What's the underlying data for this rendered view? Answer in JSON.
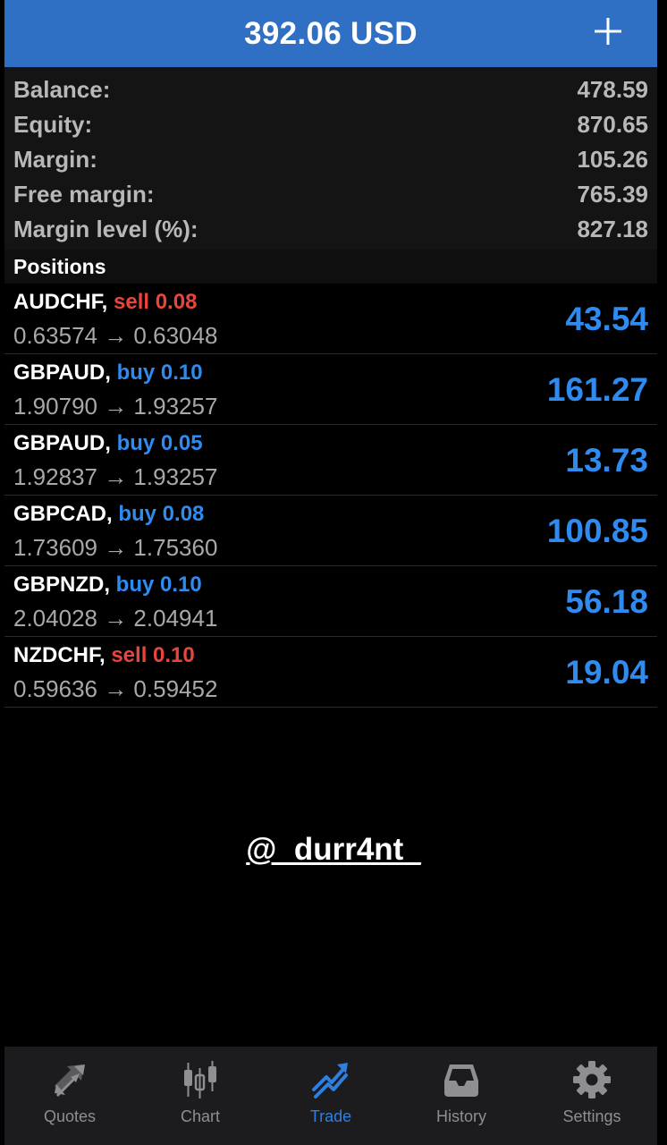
{
  "header": {
    "title": "392.06 USD"
  },
  "summary": [
    {
      "label": "Balance:",
      "value": "478.59"
    },
    {
      "label": "Equity:",
      "value": "870.65"
    },
    {
      "label": "Margin:",
      "value": "105.26"
    },
    {
      "label": "Free margin:",
      "value": "765.39"
    },
    {
      "label": "Margin level (%):",
      "value": "827.18"
    }
  ],
  "positions": {
    "title": "Positions",
    "items": [
      {
        "symbol": "AUDCHF,",
        "type": "sell 0.08",
        "side": "sell",
        "prices": "0.63574 → 0.63048",
        "profit": "43.54"
      },
      {
        "symbol": "GBPAUD,",
        "type": "buy 0.10",
        "side": "buy",
        "prices": "1.90790 → 1.93257",
        "profit": "161.27"
      },
      {
        "symbol": "GBPAUD,",
        "type": "buy 0.05",
        "side": "buy",
        "prices": "1.92837 → 1.93257",
        "profit": "13.73"
      },
      {
        "symbol": "GBPCAD,",
        "type": "buy 0.08",
        "side": "buy",
        "prices": "1.73609 → 1.75360",
        "profit": "100.85"
      },
      {
        "symbol": "GBPNZD,",
        "type": "buy 0.10",
        "side": "buy",
        "prices": "2.04028 → 2.04941",
        "profit": "56.18"
      },
      {
        "symbol": "NZDCHF,",
        "type": "sell 0.10",
        "side": "sell",
        "prices": "0.59636 → 0.59452",
        "profit": "19.04"
      }
    ]
  },
  "watermark": "@_durr4nt_",
  "tabs": [
    {
      "label": "Quotes",
      "icon": "quotes-icon"
    },
    {
      "label": "Chart",
      "icon": "chart-icon"
    },
    {
      "label": "Trade",
      "icon": "trade-icon"
    },
    {
      "label": "History",
      "icon": "history-icon"
    },
    {
      "label": "Settings",
      "icon": "settings-icon"
    }
  ],
  "active_tab": "Trade",
  "colors": {
    "header": "#2f6fc4",
    "sell": "#e8453c",
    "buy": "#2f8bf0",
    "profit": "#2f8bf0",
    "active_tab": "#2f7fe0"
  }
}
